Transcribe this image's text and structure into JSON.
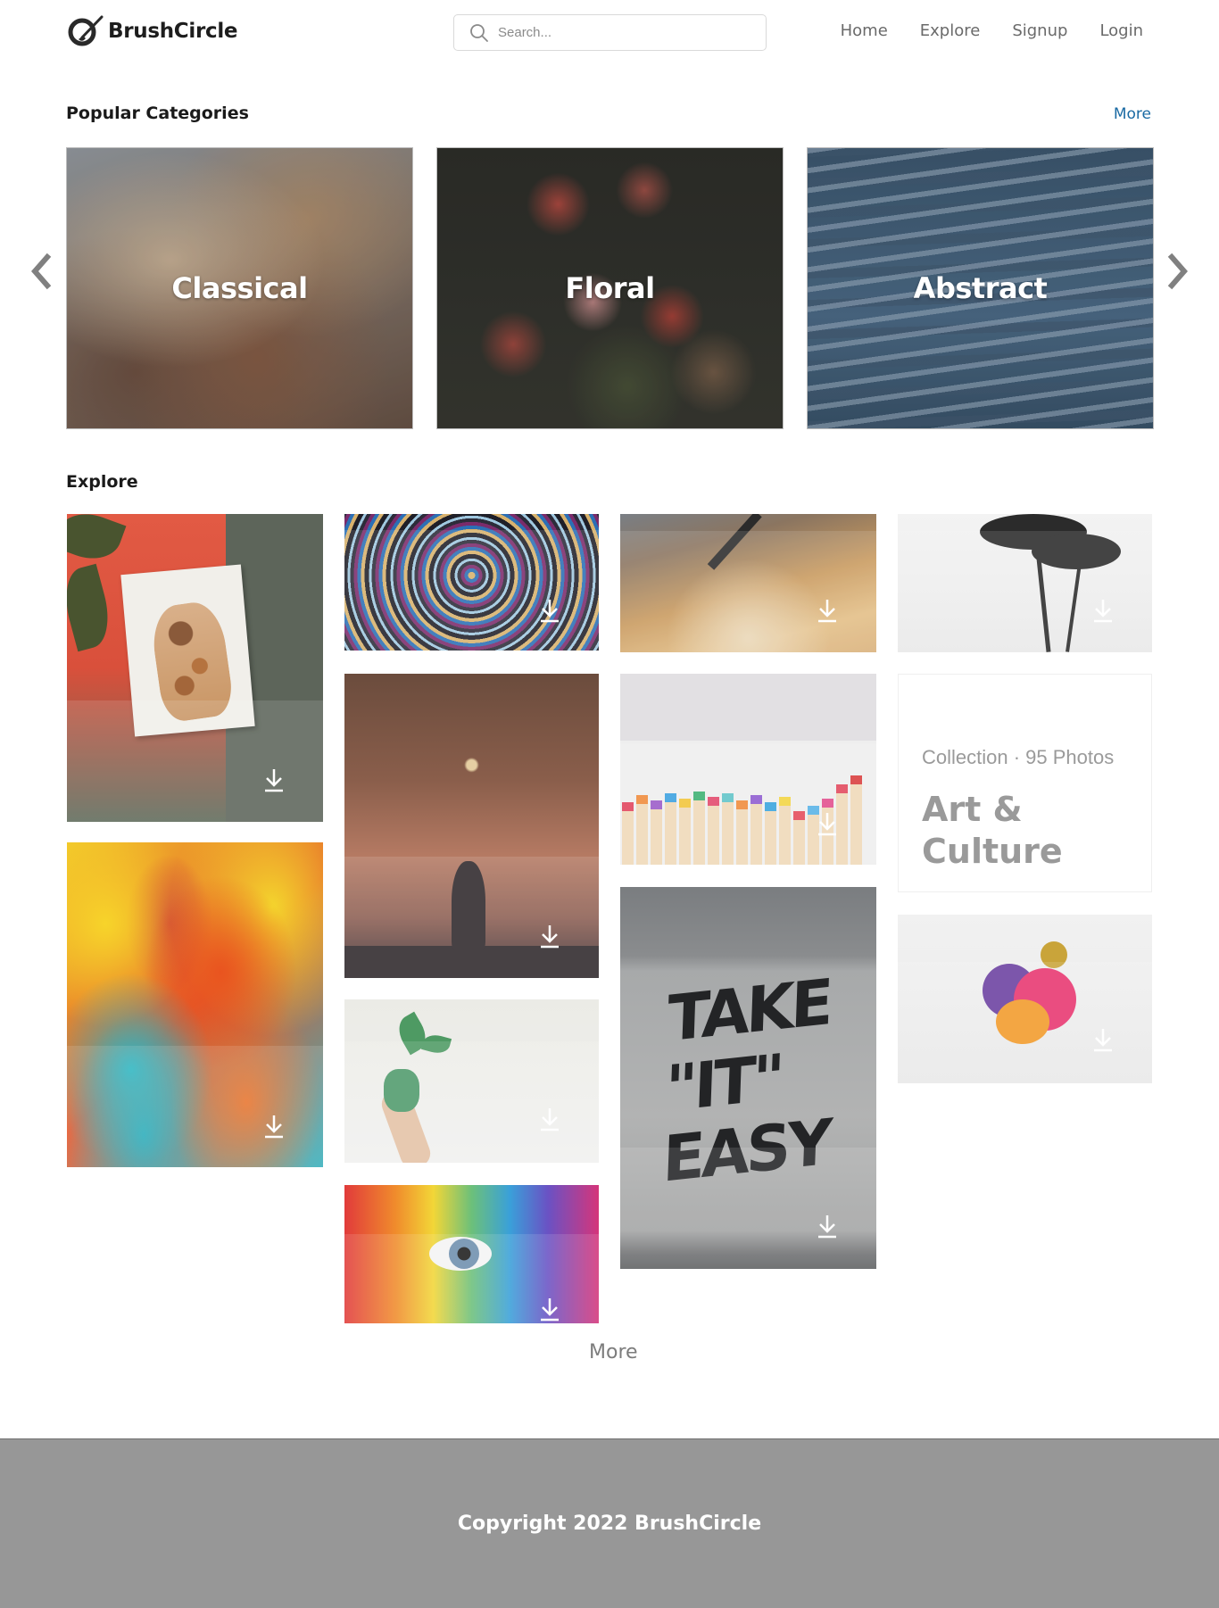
{
  "header": {
    "brand": "BrushCircle",
    "search_placeholder": "Search...",
    "nav": [
      {
        "label": "Home"
      },
      {
        "label": "Explore"
      },
      {
        "label": "Signup"
      },
      {
        "label": "Login"
      }
    ]
  },
  "categories": {
    "title": "Popular Categories",
    "more_label": "More",
    "items": [
      {
        "label": "Classical"
      },
      {
        "label": "Floral"
      },
      {
        "label": "Abstract"
      }
    ]
  },
  "explore": {
    "title": "Explore",
    "collection": {
      "meta": "Collection · 95 Photos",
      "title": "Art & Culture"
    },
    "more_label": "More"
  },
  "footer": {
    "copyright": "Copyright 2022 BrushCircle"
  },
  "icons": {
    "logo": "brush-circle-logo",
    "search": "search-icon",
    "prev": "chevron-left-icon",
    "next": "chevron-right-icon",
    "download": "download-icon"
  },
  "colors": {
    "accent_link": "#1a6aa3",
    "footer_bg": "#979797",
    "nav_text": "#6a6a6a"
  }
}
